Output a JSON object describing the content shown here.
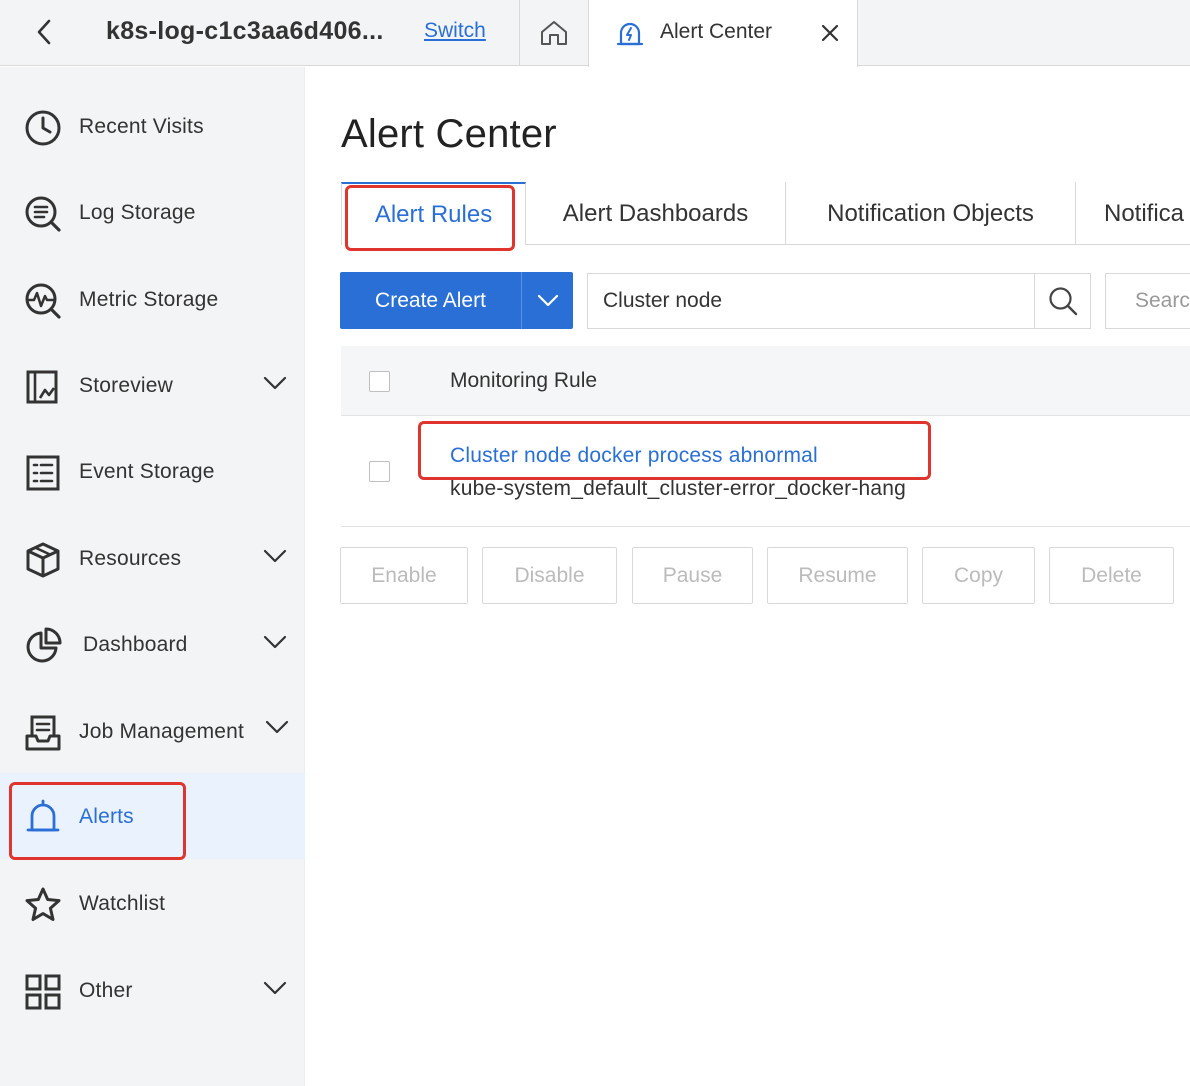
{
  "topbar": {
    "project_name": "k8s-log-c1c3aa6d406...",
    "switch_label": "Switch",
    "active_tab_label": "Alert Center"
  },
  "sidebar": {
    "items": [
      {
        "label": "Recent Visits",
        "icon": "clock-icon",
        "has_chevron": false
      },
      {
        "label": "Log Storage",
        "icon": "log-search-icon",
        "has_chevron": false
      },
      {
        "label": "Metric Storage",
        "icon": "metric-search-icon",
        "has_chevron": false
      },
      {
        "label": "Storeview",
        "icon": "storeview-icon",
        "has_chevron": true
      },
      {
        "label": "Event Storage",
        "icon": "event-list-icon",
        "has_chevron": false
      },
      {
        "label": "Resources",
        "icon": "cube-icon",
        "has_chevron": true
      },
      {
        "label": "Dashboard",
        "icon": "pie-chart-icon",
        "has_chevron": true
      },
      {
        "label": "Job Management",
        "icon": "job-inbox-icon",
        "has_chevron": true
      },
      {
        "label": "Alerts",
        "icon": "bell-icon",
        "has_chevron": false,
        "active": true
      },
      {
        "label": "Watchlist",
        "icon": "star-icon",
        "has_chevron": false
      },
      {
        "label": "Other",
        "icon": "grid-icon",
        "has_chevron": true
      }
    ]
  },
  "main": {
    "title": "Alert Center",
    "tabs": [
      {
        "label": "Alert Rules",
        "active": true
      },
      {
        "label": "Alert Dashboards"
      },
      {
        "label": "Notification Objects"
      },
      {
        "label": "Notifica"
      }
    ],
    "toolbar": {
      "create_label": "Create Alert",
      "search_value": "Cluster node",
      "search_button_label": "Searc"
    },
    "table": {
      "columns": [
        "Monitoring Rule"
      ],
      "rows": [
        {
          "name": "Cluster node docker process abnormal",
          "id": "kube-system_default_cluster-error_docker-hang"
        }
      ]
    },
    "actions": [
      "Enable",
      "Disable",
      "Pause",
      "Resume",
      "Copy",
      "Delete"
    ]
  },
  "colors": {
    "accent": "#2a6fd6",
    "highlight": "#e0342f",
    "sidebar_bg": "#f3f4f6"
  }
}
